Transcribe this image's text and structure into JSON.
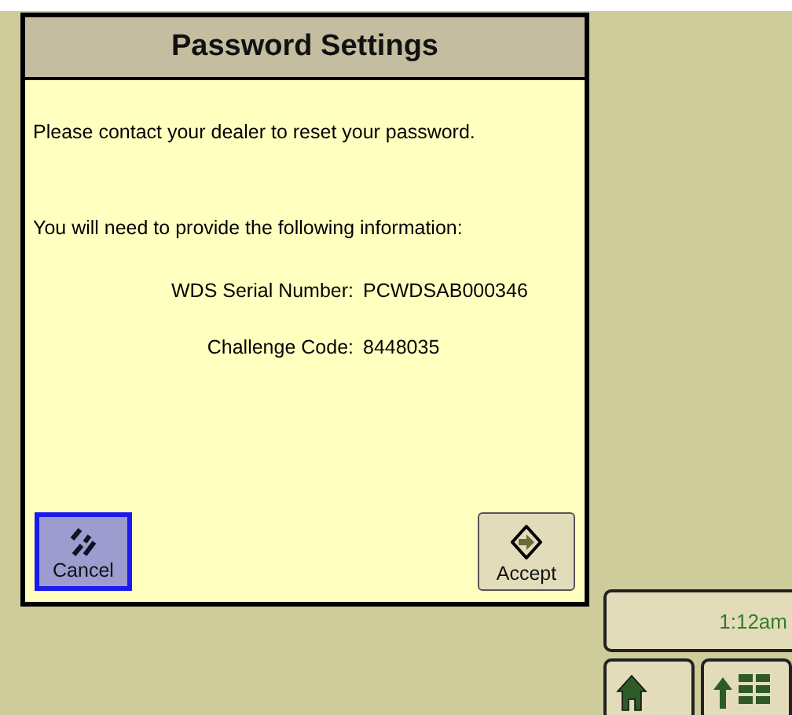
{
  "dialog": {
    "title": "Password Settings",
    "messages": [
      "Please contact your dealer to reset your password.",
      "You will need to provide the following information:"
    ],
    "fields": [
      {
        "label": "WDS Serial Number:",
        "value": "PCWDSAB000346"
      },
      {
        "label": "Challenge Code:",
        "value": "8448035"
      }
    ],
    "buttons": [
      {
        "kind": "cancel",
        "label": "Cancel",
        "selected": true
      },
      {
        "kind": "accept",
        "label": "Accept",
        "selected": false
      }
    ]
  },
  "status": {
    "time": "1:12am"
  }
}
